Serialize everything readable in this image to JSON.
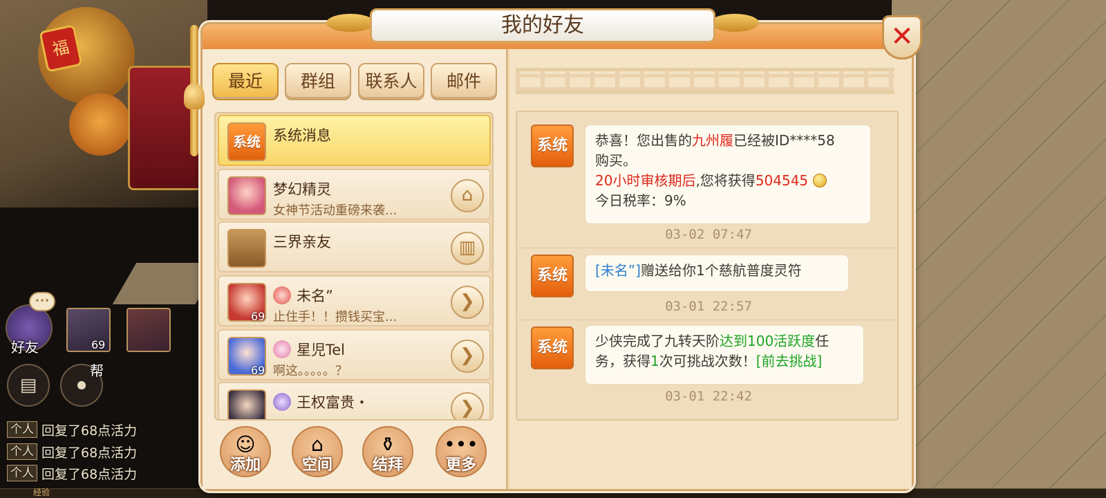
{
  "window": {
    "title": "我的好友",
    "close_icon": "close-icon"
  },
  "tabs": [
    {
      "label": "最近",
      "active": true
    },
    {
      "label": "群组",
      "active": false
    },
    {
      "label": "联系人",
      "active": false
    },
    {
      "label": "邮件",
      "active": false
    }
  ],
  "friend_list": [
    {
      "avatar_text": "系统",
      "name": "系统消息",
      "preview": "",
      "selected": true
    },
    {
      "name": "梦幻精灵",
      "preview": "女神节活动重磅来袭...",
      "action_icon": "home-icon"
    },
    {
      "name": "三界亲友",
      "preview": "",
      "action_icon": "book-icon"
    },
    {
      "name": "未名”",
      "preview": "止住手！！攒钱买宝...",
      "level": "69",
      "action_icon": "chevron-right-icon"
    },
    {
      "name": "星児Tel",
      "preview": "啊这。。。。。？",
      "level": "69",
      "action_icon": "chevron-right-icon"
    },
    {
      "name": "王权富贵・",
      "preview": "",
      "action_icon": "chevron-right-icon"
    }
  ],
  "bottom_buttons": [
    {
      "label": "添加",
      "icon": "add-person-icon"
    },
    {
      "label": "空间",
      "icon": "house-icon"
    },
    {
      "label": "结拜",
      "icon": "gourd-icon"
    },
    {
      "label": "更多",
      "icon": "more-icon"
    }
  ],
  "messages": [
    {
      "avatar_text": "系统",
      "line1_a": "恭喜！您出售的",
      "line1_item": "九州履",
      "line1_b": "已经被ID****58",
      "line2": "购买。",
      "line3_red": "20小时审核期后",
      "line3_b": ",您将获得",
      "line3_amount": "504545",
      "line4": "今日税率：9%",
      "time": "03-02 07:47"
    },
    {
      "avatar_text": "系统",
      "sender": "[未名”]",
      "text": "赠送给你1个慈航普度灵符",
      "time": "03-01 22:57"
    },
    {
      "avatar_text": "系统",
      "part_a": "少侠完成了九转天阶",
      "part_green": "达到100活跃度",
      "part_b": "任",
      "part_c": "务，获得",
      "part_count": "1",
      "part_d": "次可挑战次数！",
      "part_link": "[前去挑战]",
      "time": "03-01 22:42"
    }
  ],
  "hud": {
    "friends_label": "好友",
    "friends_bubble": "•••",
    "portrait_level": "69",
    "guild_label": "帮",
    "log_tag": "个人",
    "log_rows": [
      "回复了68点活力",
      "回复了68点活力",
      "回复了68点活力"
    ],
    "exp_label": "经验"
  },
  "background": {
    "sign_text": "福"
  }
}
